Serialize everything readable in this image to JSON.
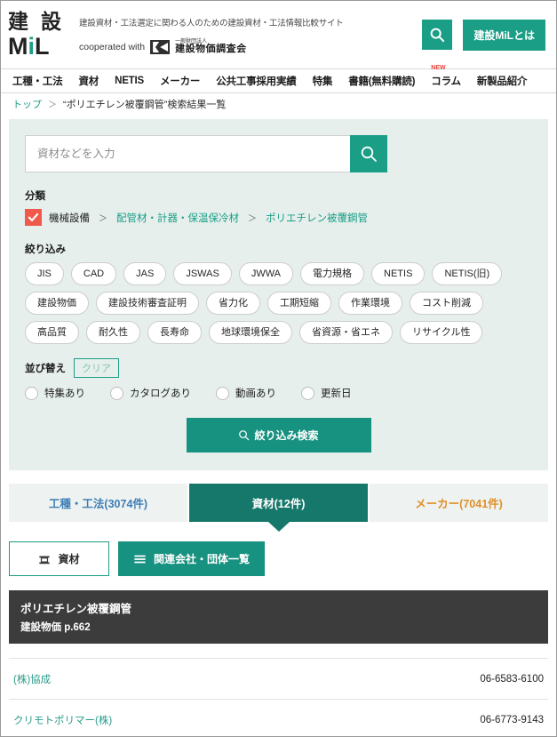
{
  "header": {
    "logo_top": "建 設",
    "logo_bottom_pre": "M",
    "logo_bottom_i": "i",
    "logo_bottom_post": "L",
    "tagline": "建設資材・工法選定に関わる人のための建設資材・工法情報比較サイト",
    "cooperated_label": "cooperated with",
    "org_small": "一般財団法人",
    "org_name": "建設物価調査会",
    "search_icon": "search-icon",
    "about_button": "建設MiLとは"
  },
  "nav": {
    "items": [
      {
        "label": "工種・工法",
        "badge": ""
      },
      {
        "label": "資材",
        "badge": ""
      },
      {
        "label": "NETIS",
        "badge": ""
      },
      {
        "label": "メーカー",
        "badge": ""
      },
      {
        "label": "公共工事採用実績",
        "badge": ""
      },
      {
        "label": "特集",
        "badge": ""
      },
      {
        "label": "書籍(無料購読)",
        "badge": ""
      },
      {
        "label": "コラム",
        "badge": "NEW"
      },
      {
        "label": "新製品紹介",
        "badge": ""
      }
    ]
  },
  "breadcrumb": {
    "home": "トップ",
    "separator": "＞",
    "current": "“ポリエチレン被覆鋼管”検索結果一覧"
  },
  "search_panel": {
    "input_placeholder": "資材などを入力",
    "input_value": "",
    "search_icon": "search-icon",
    "category_label": "分類",
    "category_checked": true,
    "category_path": [
      {
        "label": "機械設備",
        "link": false
      },
      {
        "label": "配管材・計器・保温保冷材",
        "link": true
      },
      {
        "label": "ポリエチレン被覆鋼管",
        "link": true
      }
    ],
    "category_separator": "＞",
    "refine_label": "絞り込み",
    "tag_rows": [
      [
        "JIS",
        "CAD",
        "JAS",
        "JSWAS",
        "JWWA",
        "電力規格",
        "NETIS",
        "NETIS(旧)"
      ],
      [
        "建設物価",
        "建設技術審査証明",
        "省力化",
        "工期短縮",
        "作業環境",
        "コスト削減"
      ],
      [
        "高品質",
        "耐久性",
        "長寿命",
        "地球環境保全",
        "省資源・省エネ",
        "リサイクル性"
      ]
    ],
    "sort_label": "並び替え",
    "clear_label": "クリア",
    "sort_options": [
      "特集あり",
      "カタログあり",
      "動画あり",
      "更新日"
    ],
    "refine_button": "絞り込み検索"
  },
  "tabs": [
    {
      "label": "工種・工法(3074件)",
      "active": false
    },
    {
      "label": "資材(12件)",
      "active": true
    },
    {
      "label": "メーカー(7041件)",
      "active": false
    }
  ],
  "sub_buttons": [
    {
      "label": "資材",
      "icon": "material-icon",
      "style": "outline"
    },
    {
      "label": "関連会社・団体一覧",
      "icon": "list-icon",
      "style": "filled"
    }
  ],
  "results": {
    "title": "ポリエチレン被覆鋼管",
    "subtitle": "建設物価 p.662",
    "companies": [
      {
        "name": "(株)協成",
        "tel": "06-6583-6100"
      },
      {
        "name": "クリモトポリマー(株)",
        "tel": "06-6773-9143"
      }
    ]
  },
  "colors": {
    "brand_teal": "#1a9e86",
    "deep_teal": "#16786a",
    "panel_bg": "#e6efec",
    "checkbox_orange": "#f0594c",
    "tab_blue": "#3f7fb5",
    "tab_orange": "#e09029",
    "result_header": "#3c3c3c",
    "badge_red": "#e8413a"
  }
}
